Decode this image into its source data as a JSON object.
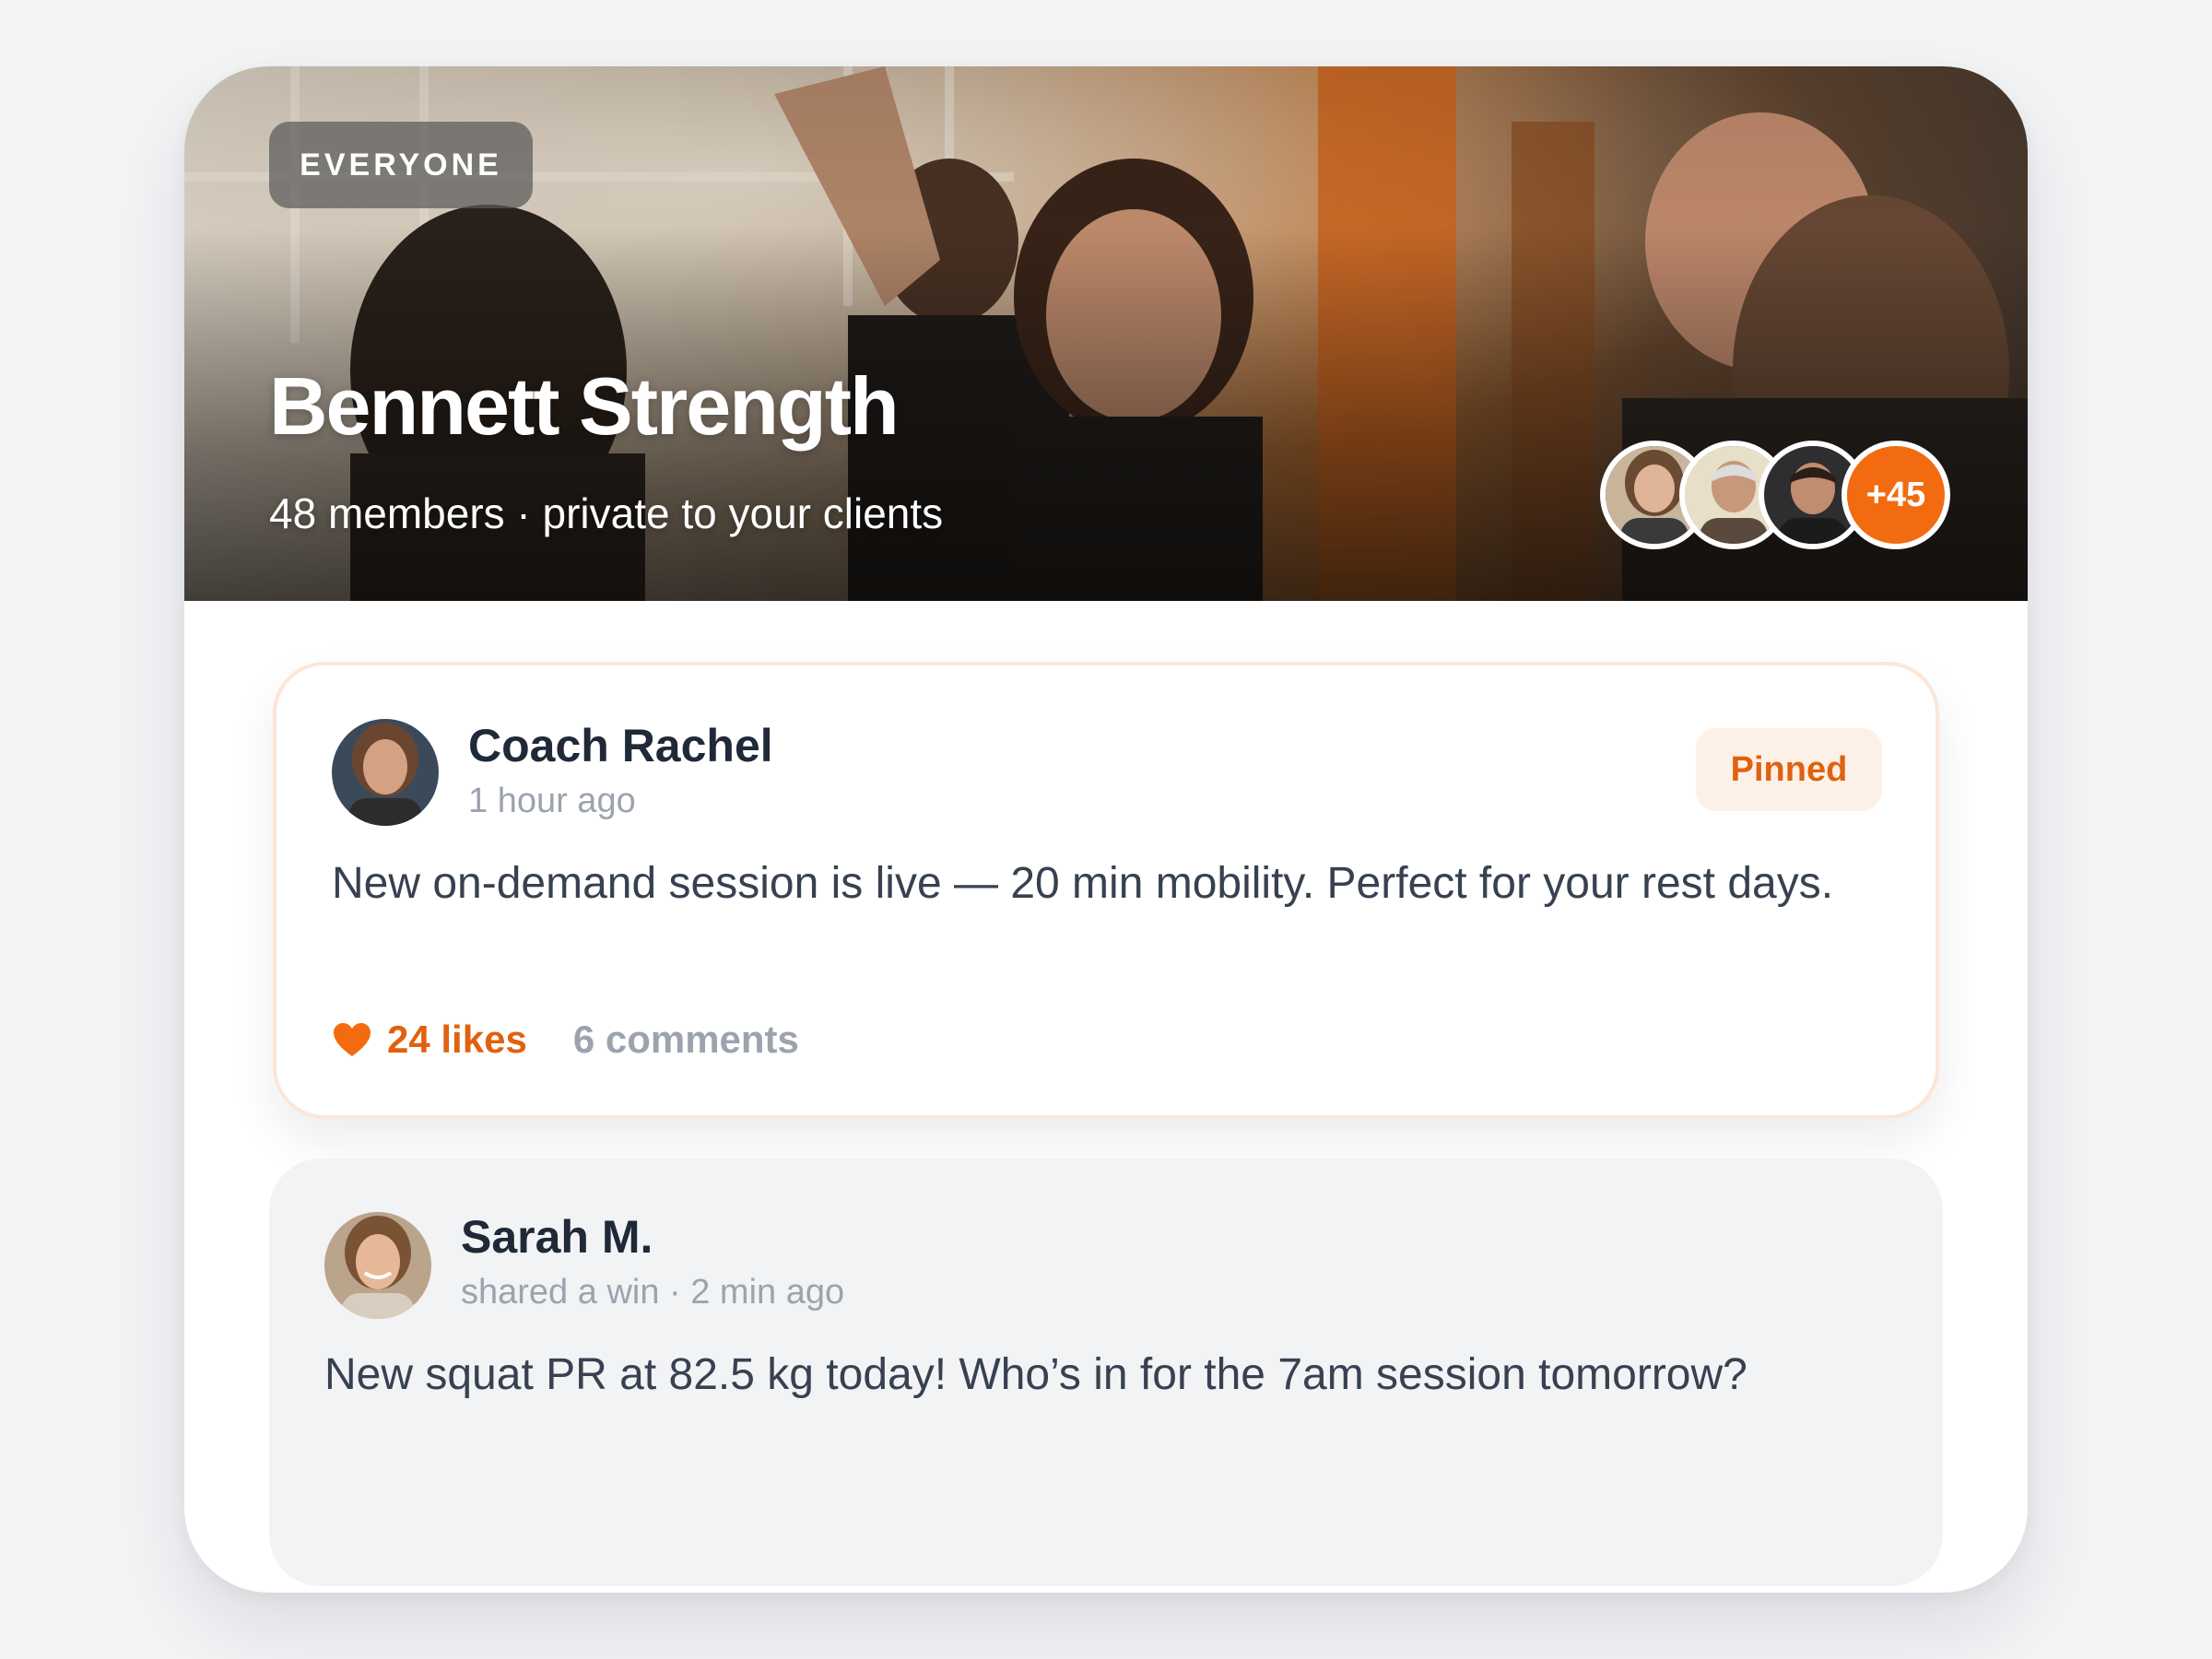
{
  "colors": {
    "accent": "#f26b11",
    "accent_text": "#e0620e",
    "pinned_bg": "#fdf1e7",
    "card_bg": "#ffffff",
    "page_bg": "#f3f4f6"
  },
  "group": {
    "audience": "EVERYONE",
    "title": "Bennett Strength",
    "subtitle": "48 members · private to your clients",
    "extra_members": "+45"
  },
  "posts": [
    {
      "author": "Coach Rachel",
      "meta": "1 hour ago",
      "badge": "Pinned",
      "body": "New on-demand session is live — 20 min mobility. Perfect for your rest days.",
      "likes": "24 likes",
      "comments": "6 comments",
      "like_icon": "heart-icon"
    },
    {
      "author": "Sarah M.",
      "meta": "shared a win · 2 min ago",
      "body": "New squat PR at 82.5 kg today! Who’s in for the 7am session tomorrow?"
    }
  ]
}
